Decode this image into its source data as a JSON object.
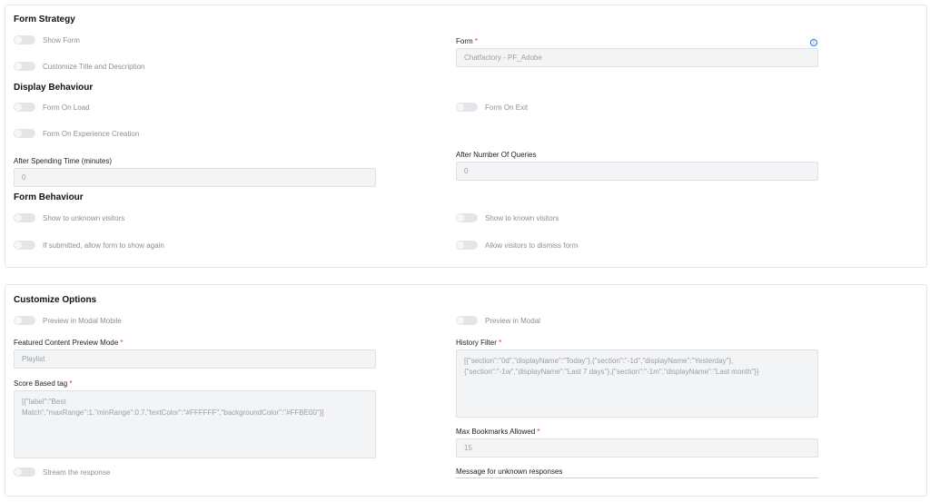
{
  "form_strategy": {
    "title": "Form Strategy",
    "show_form": "Show Form",
    "customize_title": "Customize Title and Description",
    "form_label": "Form",
    "required_mark": "*",
    "form_value": "Chatfactory - PF_Adobe",
    "info_icon_glyph": "i"
  },
  "display_behaviour": {
    "title": "Display Behaviour",
    "form_on_load": "Form On Load",
    "form_on_exit": "Form On Exit",
    "form_on_experience": "Form On Experience Creation",
    "after_time_label": "After Spending Time (minutes)",
    "after_time_value": "0",
    "after_queries_label": "After Number Of Queries",
    "after_queries_value": "0"
  },
  "form_behaviour": {
    "title": "Form Behaviour",
    "unknown_visitors": "Show to unknown visitors",
    "known_visitors": "Show to known visitors",
    "show_again": "If submitted, allow form to show again",
    "dismiss_form": "Allow visitors to dismiss form"
  },
  "customize_options": {
    "title": "Customize Options",
    "preview_modal_mobile": "Preview in Modal Mobile",
    "preview_modal": "Preview in Modal",
    "featured_mode_label": "Featured Content Preview Mode",
    "featured_mode_value": "Playlist",
    "history_filter_label": "History Filter",
    "history_filter_value": "[{\"section\":\"0d\",\"displayName\":\"Today\"},{\"section\":\"-1d\",\"displayName\":\"Yesterday\"},\n{\"section\":\"-1w\",\"displayName\":\"Last 7 days\"},{\"section\":\"-1m\",\"displayName\":\"Last month\"}]",
    "score_tag_label": "Score Based tag",
    "score_tag_value": "[{\"label\":\"Best\nMatch\",\"maxRange\":1,\"minRange\":0.7,\"textColor\":\"#FFFFFF\",\"backgroundColor\":\"#FFBE00\"}]",
    "max_bookmarks_label": "Max Bookmarks Allowed",
    "max_bookmarks_value": "15",
    "stream_response": "Stream the response",
    "unknown_responses_label": "Message for unknown responses"
  },
  "colors": {
    "required": "#e0352b",
    "info_icon": "#2d6ed6",
    "toggle_off": "#e3e5e8",
    "field_bg": "#f3f4f6"
  }
}
